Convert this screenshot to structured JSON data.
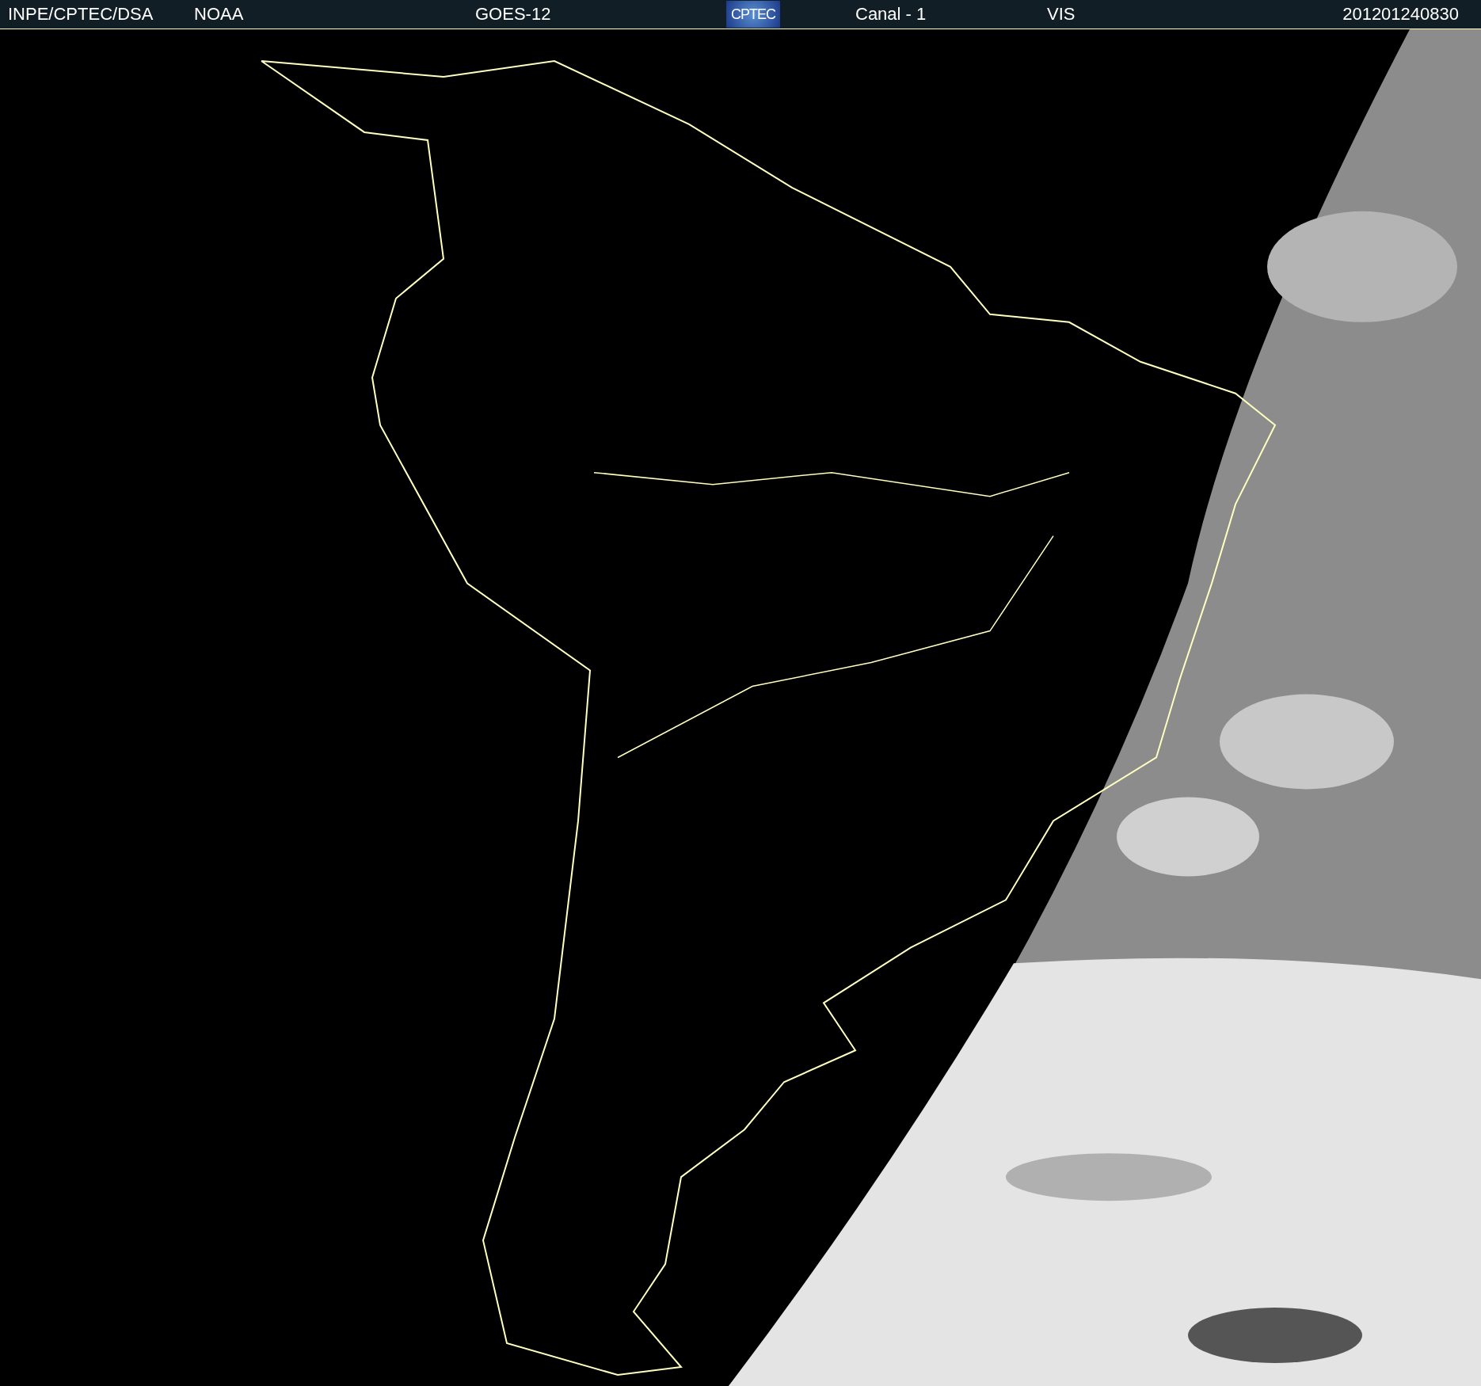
{
  "header": {
    "items": [
      {
        "kind": "text",
        "text": "INPE/CPTEC/DSA"
      },
      {
        "kind": "text",
        "text": "NOAA"
      },
      {
        "kind": "text",
        "text": "GOES-12"
      },
      {
        "kind": "logo",
        "text": "CPTEC"
      },
      {
        "kind": "text",
        "text": "Canal - 1"
      },
      {
        "kind": "text",
        "text": "VIS"
      },
      {
        "kind": "text",
        "text": "201201240830"
      }
    ]
  }
}
